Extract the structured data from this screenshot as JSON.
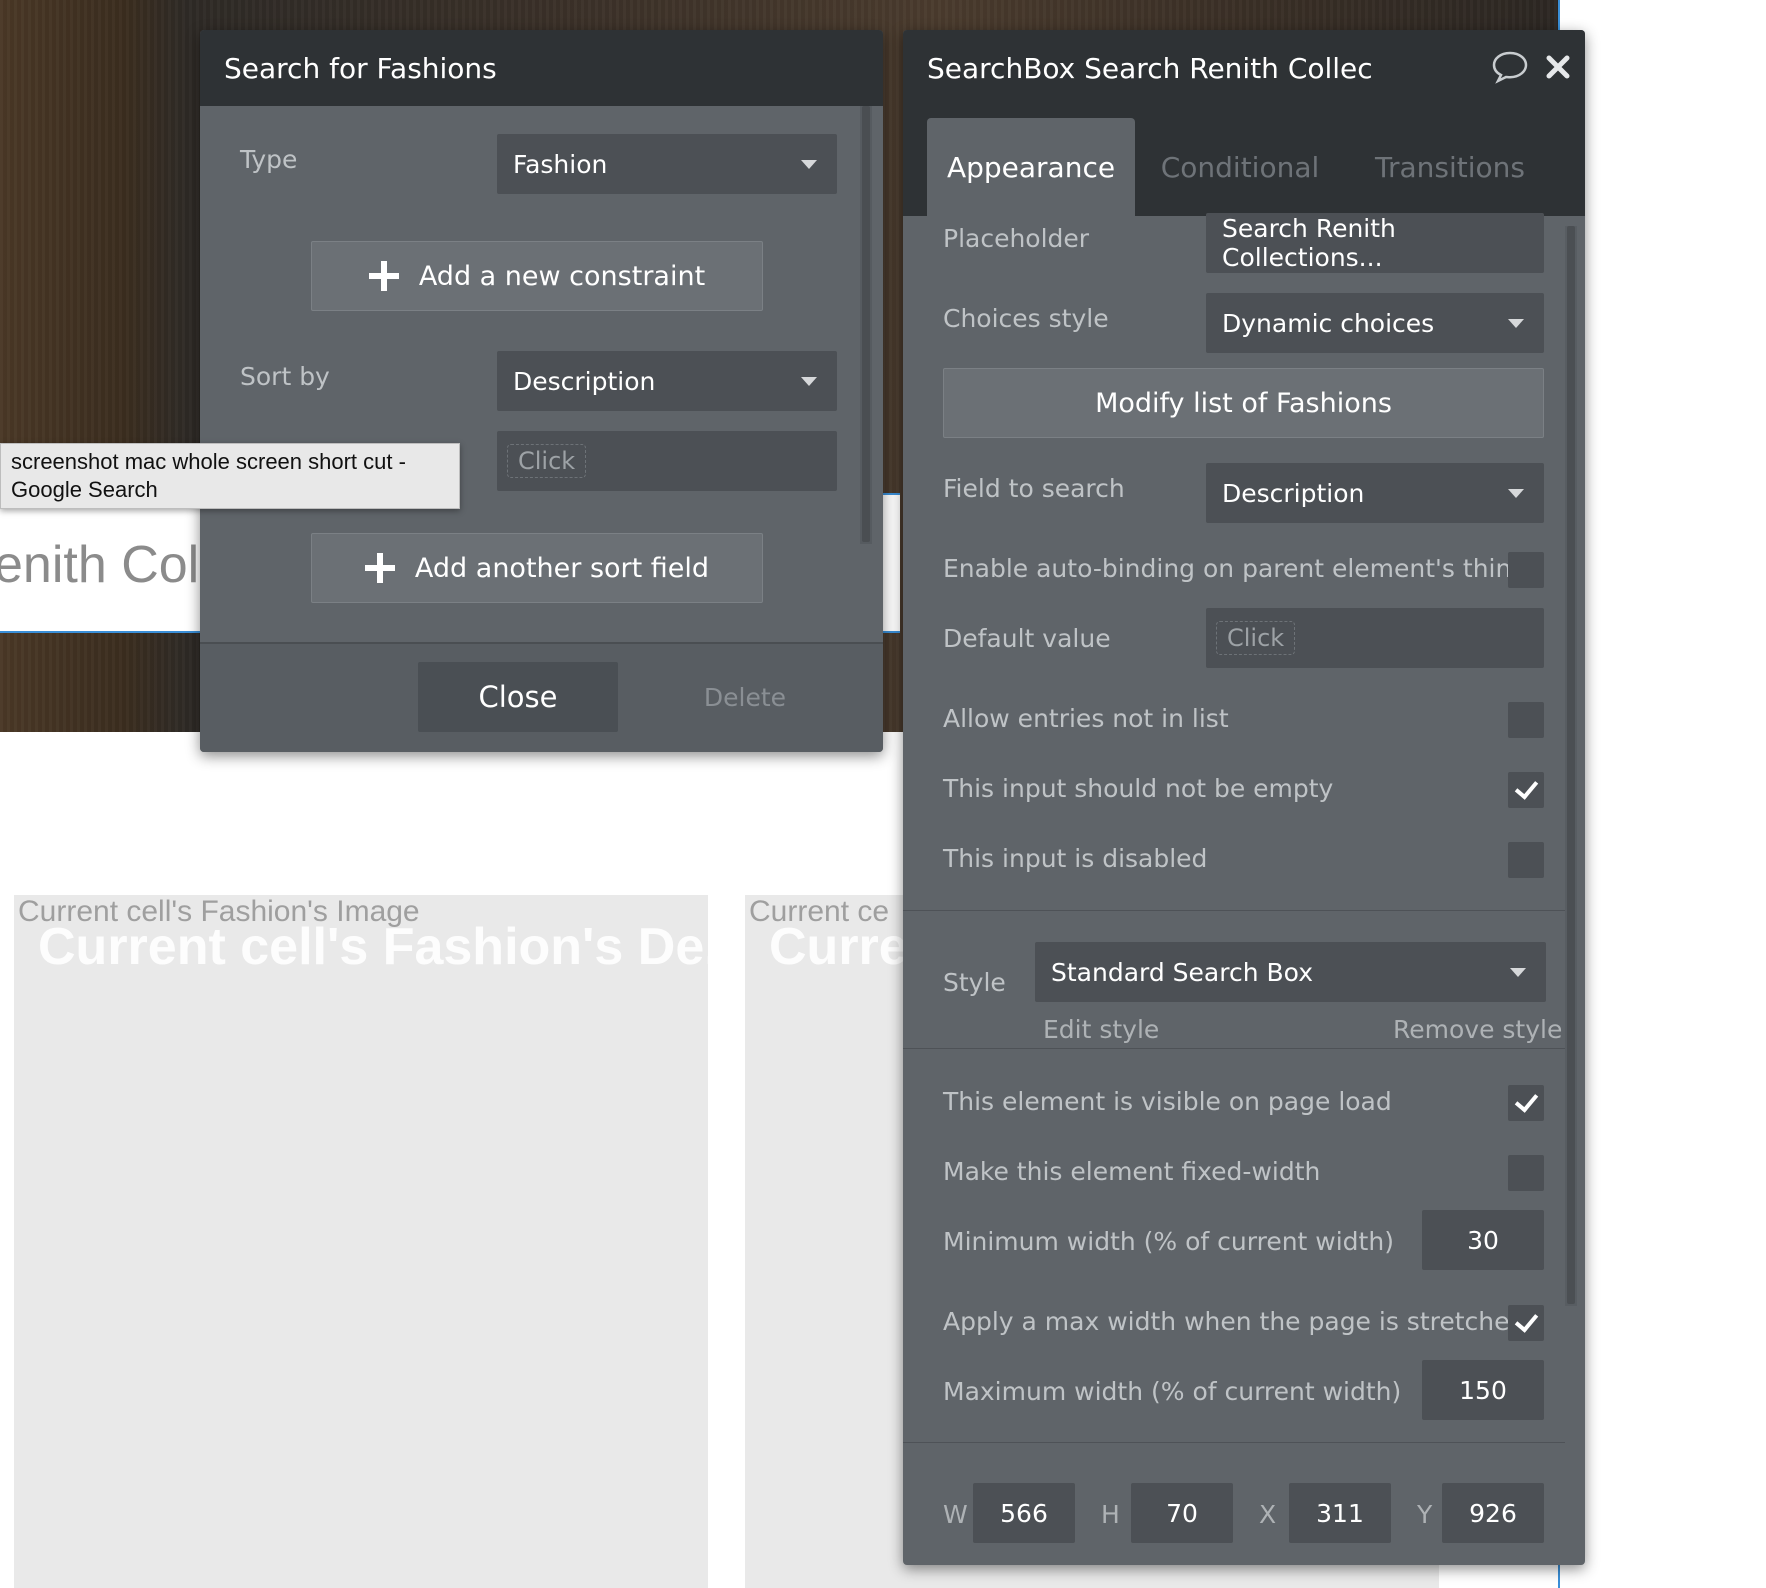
{
  "background": {
    "searchbar_text": "enith Colle",
    "cells": [
      {
        "image_label": "Current cell's Fashion's Image",
        "desc_label": "Current cell's Fashion's De..."
      },
      {
        "image_label": "Current ce",
        "desc_label": "Curre"
      }
    ]
  },
  "tooltip": {
    "text": "screenshot mac whole screen short cut - Google Search"
  },
  "search_panel": {
    "title": "Search for Fashions",
    "type_label": "Type",
    "type_value": "Fashion",
    "add_constraint_label": "Add a new constraint",
    "sort_by_label": "Sort by",
    "sort_by_value": "Description",
    "sort_order_placeholder": "Click",
    "add_sort_field_label": "Add another sort field",
    "close_label": "Close",
    "delete_label": "Delete"
  },
  "property_panel": {
    "title": "SearchBox Search Renith Collec",
    "icons": {
      "comment": "comment-icon",
      "close": "close-icon"
    },
    "tabs": [
      {
        "label": "Appearance",
        "active": true
      },
      {
        "label": "Conditional",
        "active": false
      },
      {
        "label": "Transitions",
        "active": false
      }
    ],
    "placeholder_label": "Placeholder",
    "placeholder_value": "Search Renith Collections...",
    "choices_style_label": "Choices style",
    "choices_style_value": "Dynamic choices",
    "modify_list_label": "Modify list of Fashions",
    "field_to_search_label": "Field to search",
    "field_to_search_value": "Description",
    "auto_binding_label": "Enable auto-binding on parent element's thing",
    "auto_binding_checked": false,
    "default_value_label": "Default value",
    "default_value_placeholder": "Click",
    "allow_entries_label": "Allow entries not in list",
    "allow_entries_checked": false,
    "not_empty_label": "This input should not be empty",
    "not_empty_checked": true,
    "disabled_label": "This input is disabled",
    "disabled_checked": false,
    "style_label": "Style",
    "style_value": "Standard Search Box",
    "edit_style_label": "Edit style",
    "remove_style_label": "Remove style",
    "visible_on_load_label": "This element is visible on page load",
    "visible_on_load_checked": true,
    "fixed_width_label": "Make this element fixed-width",
    "fixed_width_checked": false,
    "min_width_label": "Minimum width (% of current width)",
    "min_width_value": "30",
    "max_width_apply_label": "Apply a max width when the page is stretched",
    "max_width_apply_checked": true,
    "max_width_label": "Maximum width (% of current width)",
    "max_width_value": "150",
    "geometry_fields": [
      {
        "label": "W",
        "value": "566"
      },
      {
        "label": "H",
        "value": "70"
      },
      {
        "label": "X",
        "value": "311"
      },
      {
        "label": "Y",
        "value": "926"
      }
    ]
  }
}
